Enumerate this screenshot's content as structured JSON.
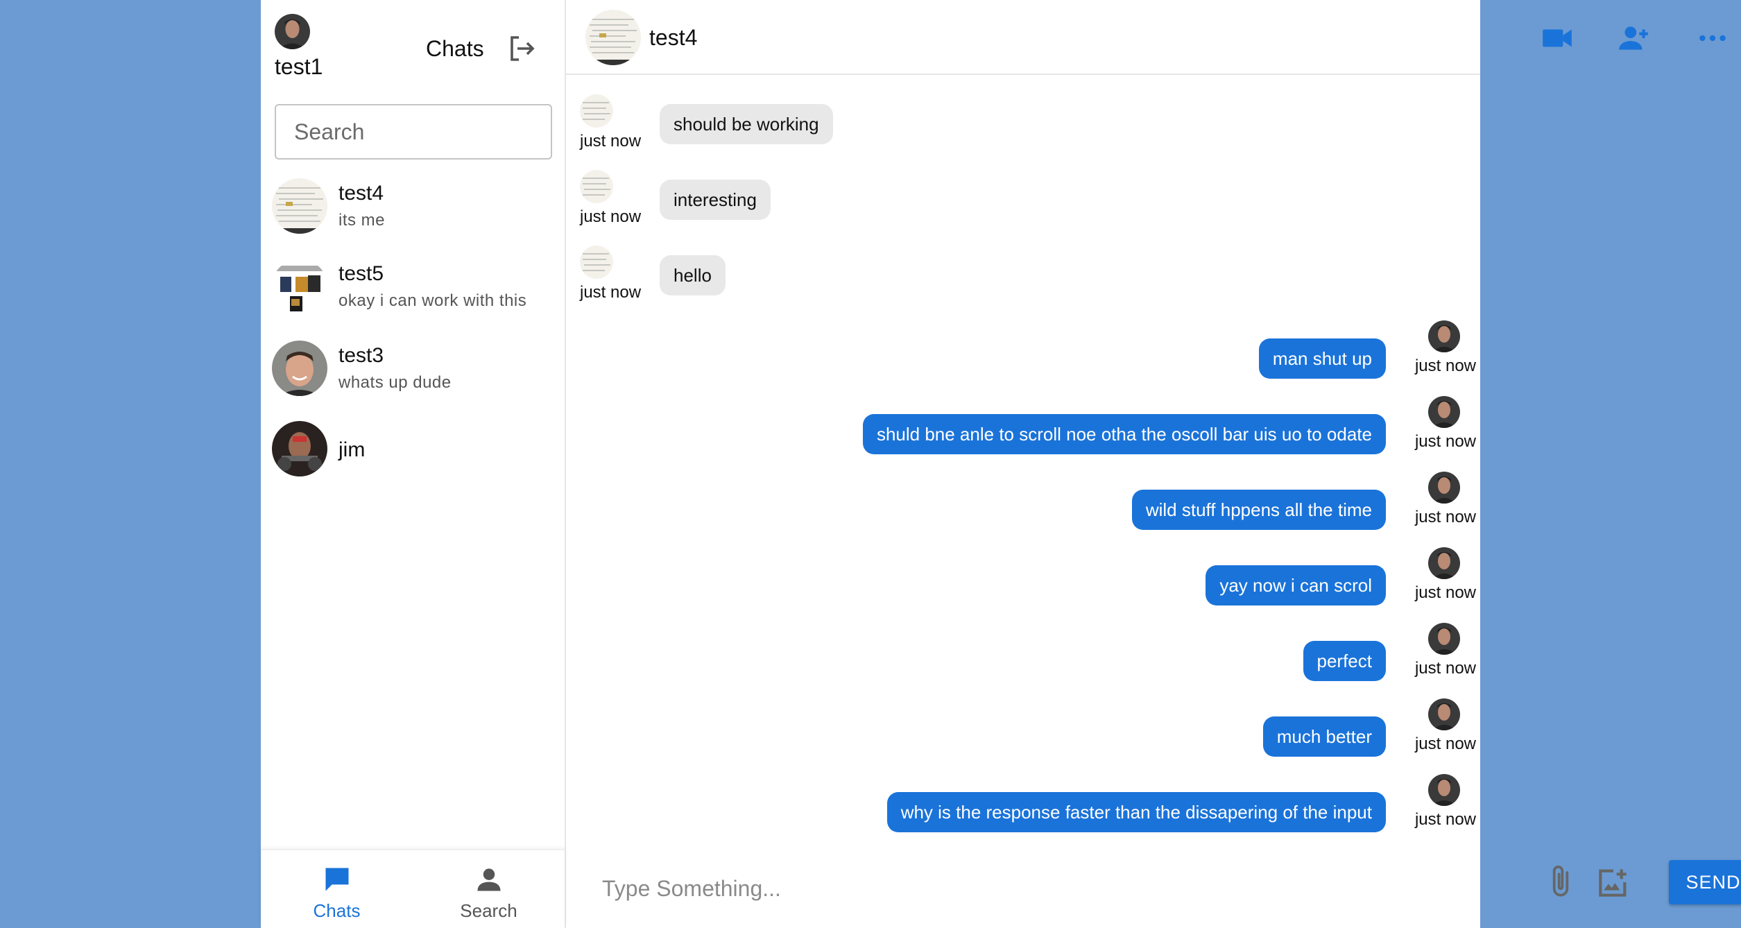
{
  "sidebar": {
    "me": {
      "name": "test1"
    },
    "title": "Chats",
    "search_placeholder": "Search",
    "contacts": [
      {
        "name": "test4",
        "preview": "its me"
      },
      {
        "name": "test5",
        "preview": "okay i can work with this"
      },
      {
        "name": "test3",
        "preview": "whats up dude"
      },
      {
        "name": "jim",
        "preview": ""
      }
    ],
    "nav": [
      {
        "label": "Chats",
        "active": true
      },
      {
        "label": "Search",
        "active": false
      }
    ]
  },
  "chat": {
    "header": {
      "name": "test4"
    },
    "messages": [
      {
        "text": "should be working",
        "time": "just now",
        "direction": "in"
      },
      {
        "text": "interesting",
        "time": "just now",
        "direction": "in"
      },
      {
        "text": "hello",
        "time": "just now",
        "direction": "in"
      },
      {
        "text": "man shut up",
        "time": "just now",
        "direction": "out"
      },
      {
        "text": "shuld bne anle to scroll noe otha the oscoll bar uis uo to odate",
        "time": "just now",
        "direction": "out"
      },
      {
        "text": "wild stuff hppens all the time",
        "time": "just now",
        "direction": "out"
      },
      {
        "text": "yay now i can scrol",
        "time": "just now",
        "direction": "out"
      },
      {
        "text": "perfect",
        "time": "just now",
        "direction": "out"
      },
      {
        "text": "much better",
        "time": "just now",
        "direction": "out"
      },
      {
        "text": "why is the response faster than the dissapering of the input",
        "time": "just now",
        "direction": "out"
      }
    ],
    "composer": {
      "placeholder": "Type Something...",
      "send_label": "SEND"
    }
  },
  "colors": {
    "background": "#6b9bd2",
    "accent": "#1a73d9",
    "incoming_bubble": "#e8e8e8"
  },
  "icons": [
    "logout-icon",
    "video-call-icon",
    "add-person-icon",
    "more-horizontal-icon",
    "attachment-icon",
    "add-image-icon",
    "chat-bubble-icon",
    "person-icon"
  ]
}
